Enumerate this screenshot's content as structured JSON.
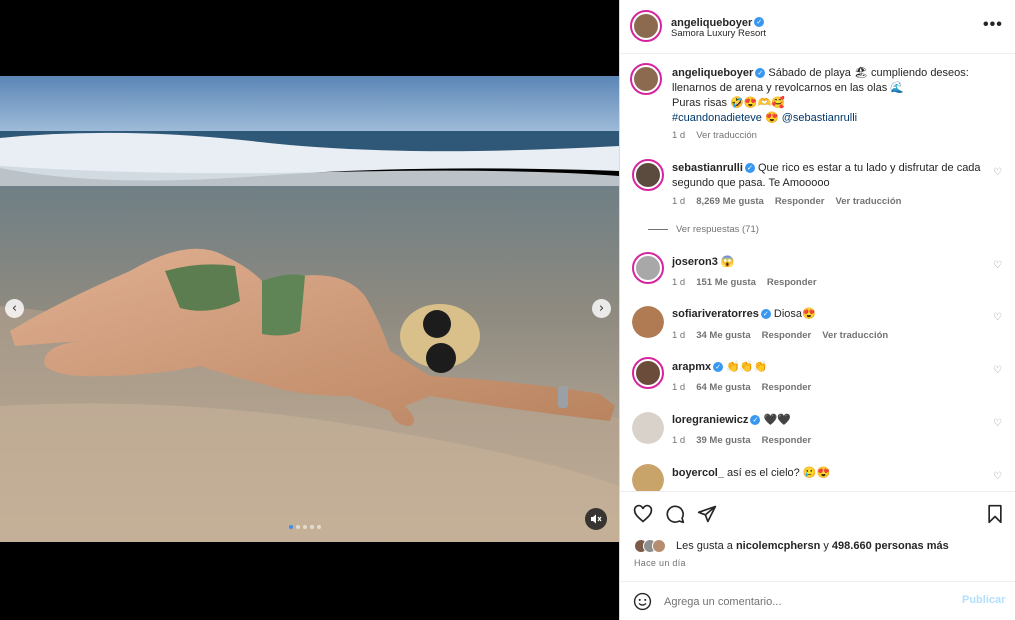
{
  "media": {
    "prev_label": "‹",
    "next_label": "›",
    "dots": 5,
    "active_dot": 0,
    "mute_icon": "speaker-muted-icon"
  },
  "header": {
    "username": "angeliqueboyer",
    "location": "Samora Luxury Resort",
    "more_label": "•••"
  },
  "caption": {
    "username": "angeliqueboyer",
    "text_line1": "Sábado de playa 🏖 cumpliendo deseos:",
    "text_line2": "llenarnos de arena y revolcarnos en las olas 🌊",
    "text_line3": "Puras risas 🤣😍🫶🥰",
    "hashtag": "#cuandonadieteve",
    "mention_emoji": "😍",
    "mention": "@sebastianrulli",
    "time": "1 d",
    "translate": "Ver traducción"
  },
  "comments": [
    {
      "username": "sebastianrulli",
      "verified": true,
      "text_line1": "Que rico es estar a tu lado y disfrutar de cada",
      "text_line2": "segundo que pasa. Te Amooooo",
      "time": "1 d",
      "likes": "8,269 Me gusta",
      "reply": "Responder",
      "translate": "Ver traducción"
    },
    {
      "username": "joseron3",
      "verified": false,
      "text_line1": "😱",
      "time": "1 d",
      "likes": "151 Me gusta",
      "reply": "Responder"
    },
    {
      "username": "sofiariveratorres",
      "verified": true,
      "text_line1": "Diosa😍",
      "time": "1 d",
      "likes": "34 Me gusta",
      "reply": "Responder",
      "translate": "Ver traducción"
    },
    {
      "username": "arapmx",
      "verified": true,
      "text_line1": "👏👏👏",
      "time": "1 d",
      "likes": "64 Me gusta",
      "reply": "Responder"
    },
    {
      "username": "loregraniewicz",
      "verified": true,
      "text_line1": "🖤🖤",
      "time": "1 d",
      "likes": "39 Me gusta",
      "reply": "Responder"
    },
    {
      "username": "boyercol_",
      "verified": false,
      "text_line1": "así es el cielo? 🥲😍"
    }
  ],
  "view_replies": "Ver respuestas (71)",
  "likes": {
    "prefix": "Les gusta a",
    "user": "nicolemcphersn",
    "middle": "y",
    "count": "498.660 personas más"
  },
  "when": "Hace un día",
  "composer": {
    "placeholder": "Agrega un comentario...",
    "publish": "Publicar"
  },
  "colors": {
    "accent": "#3897f0",
    "link": "#00376b",
    "muted": "#737373",
    "publish_disabled": "#b2dffc",
    "story_ring": "#d6249f"
  }
}
